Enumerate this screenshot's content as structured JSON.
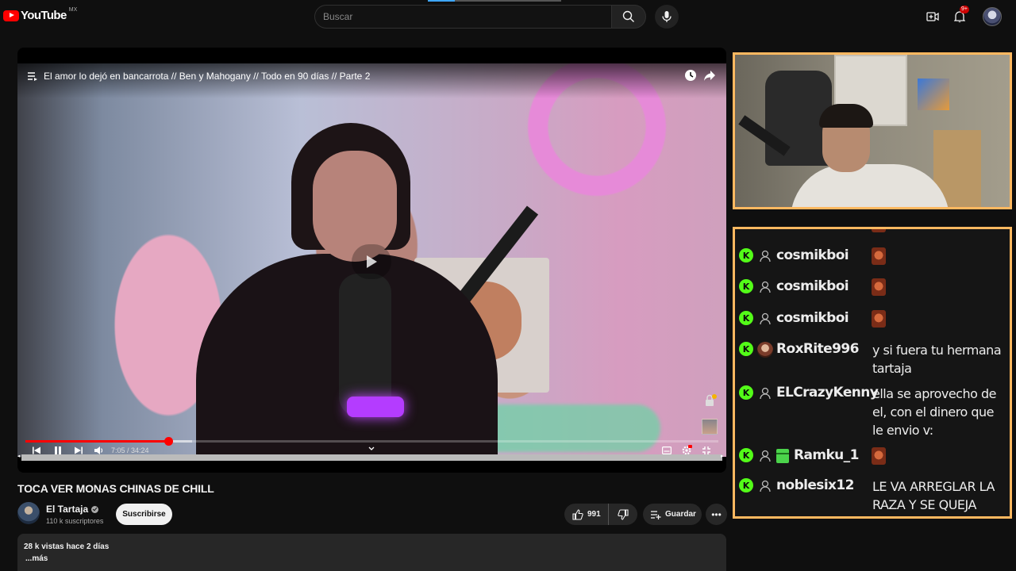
{
  "topbar": {
    "logo_text": "YouTube",
    "logo_region": "MX",
    "search_placeholder": "Buscar",
    "notification_count": "9+"
  },
  "player": {
    "overlay_title": "El amor lo dejó en bancarrota // Ben y Mahogany // Todo en 90 días // Parte 2",
    "current_time": "7:05",
    "duration": "34:24",
    "time_text": "7:05 / 34:24",
    "progress_fraction": 0.206,
    "loaded_fraction": 0.24,
    "accent_color": "#ff0000"
  },
  "video": {
    "title": "TOCA VER MONAS CHINAS DE CHILL",
    "channel_name": "El Tartaja",
    "subscribers": "110 k suscriptores",
    "subscribe_label": "Suscribirse",
    "like_count": "991",
    "save_label": "Guardar",
    "description_stats": "28 k vistas  hace 2 días",
    "description_more": "...más"
  },
  "stream": {
    "frame_color": "#ffb860",
    "chat_badge_color": "#53fc18",
    "chat_badge_letter": "K",
    "messages": [
      {
        "user": "cosmikboi",
        "text": "",
        "emote": true
      },
      {
        "user": "cosmikboi",
        "text": "",
        "emote": true
      },
      {
        "user": "cosmikboi",
        "text": "",
        "emote": true
      },
      {
        "user": "RoxRite996",
        "text": "y si fuera tu hermana tartaja",
        "avatar": true
      },
      {
        "user": "ELCrazyKenny",
        "text": "ella se aprovecho de el, con el dinero que le envio v:"
      },
      {
        "user": "Ramku_1",
        "text": "",
        "emote": true,
        "gift": true
      },
      {
        "user": "noblesix12",
        "text": "LE VA ARREGLAR LA RAZA Y SE QUEJA"
      }
    ]
  }
}
